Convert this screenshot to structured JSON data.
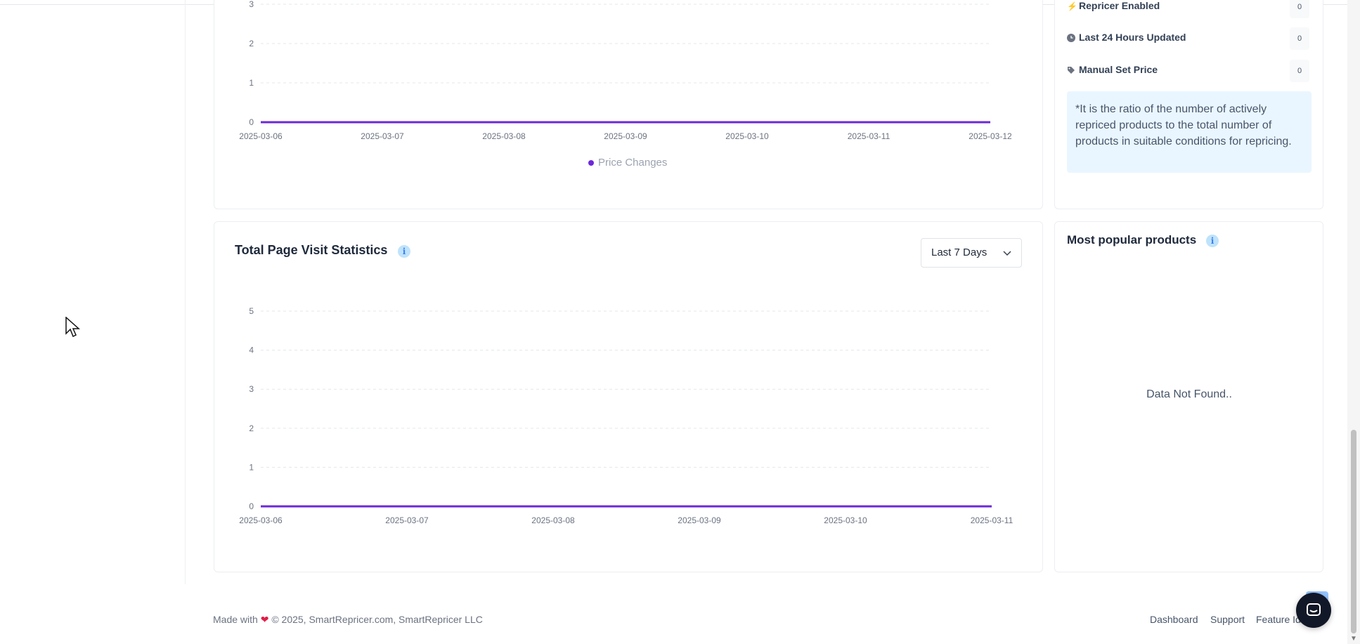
{
  "price_chart": {
    "y_ticks": [
      "0",
      "1",
      "2",
      "3"
    ],
    "x_ticks": [
      "2025-03-06",
      "2025-03-07",
      "2025-03-08",
      "2025-03-09",
      "2025-03-10",
      "2025-03-11",
      "2025-03-12"
    ],
    "legend": "Price Changes"
  },
  "stats": {
    "items": [
      {
        "label": "Repricer Enabled",
        "value": "0",
        "icon": "lightning-icon"
      },
      {
        "label": "Last 24 Hours Updated",
        "value": "0",
        "icon": "clock-icon"
      },
      {
        "label": "Manual Set Price",
        "value": "0",
        "icon": "tag-icon"
      }
    ],
    "note": "*It is the ratio of the number of actively repriced products to the total number of products in suitable conditions for repricing."
  },
  "visits": {
    "title": "Total Page Visit Statistics",
    "range_label": "Last 7 Days",
    "y_ticks": [
      "0",
      "1",
      "2",
      "3",
      "4",
      "5"
    ],
    "x_ticks": [
      "2025-03-06",
      "2025-03-07",
      "2025-03-08",
      "2025-03-09",
      "2025-03-10",
      "2025-03-11"
    ]
  },
  "popular": {
    "title": "Most popular products",
    "empty_text": "Data Not Found.."
  },
  "footer": {
    "made_with": "Made with",
    "copyright": "© 2025, SmartRepricer.com, SmartRepricer LLC",
    "links": [
      "Dashboard",
      "Support",
      "Feature Id"
    ]
  },
  "colors": {
    "series": "#6d28d9",
    "accent": "#3b82f6"
  },
  "chart_data": [
    {
      "type": "line",
      "x": [
        "2025-03-06",
        "2025-03-07",
        "2025-03-08",
        "2025-03-09",
        "2025-03-10",
        "2025-03-11",
        "2025-03-12"
      ],
      "series": [
        {
          "name": "Price Changes",
          "values": [
            0,
            0,
            0,
            0,
            0,
            0,
            0
          ]
        }
      ],
      "title": "",
      "xlabel": "",
      "ylabel": "",
      "ylim": [
        0,
        3
      ],
      "grid": true,
      "legend": "bottom"
    },
    {
      "type": "line",
      "x": [
        "2025-03-06",
        "2025-03-07",
        "2025-03-08",
        "2025-03-09",
        "2025-03-10",
        "2025-03-11"
      ],
      "series": [
        {
          "values": [
            0,
            0,
            0,
            0,
            0,
            0
          ]
        }
      ],
      "title": "Total Page Visit Statistics",
      "xlabel": "",
      "ylabel": "",
      "ylim": [
        0,
        5
      ],
      "grid": true,
      "legend": "none"
    }
  ]
}
